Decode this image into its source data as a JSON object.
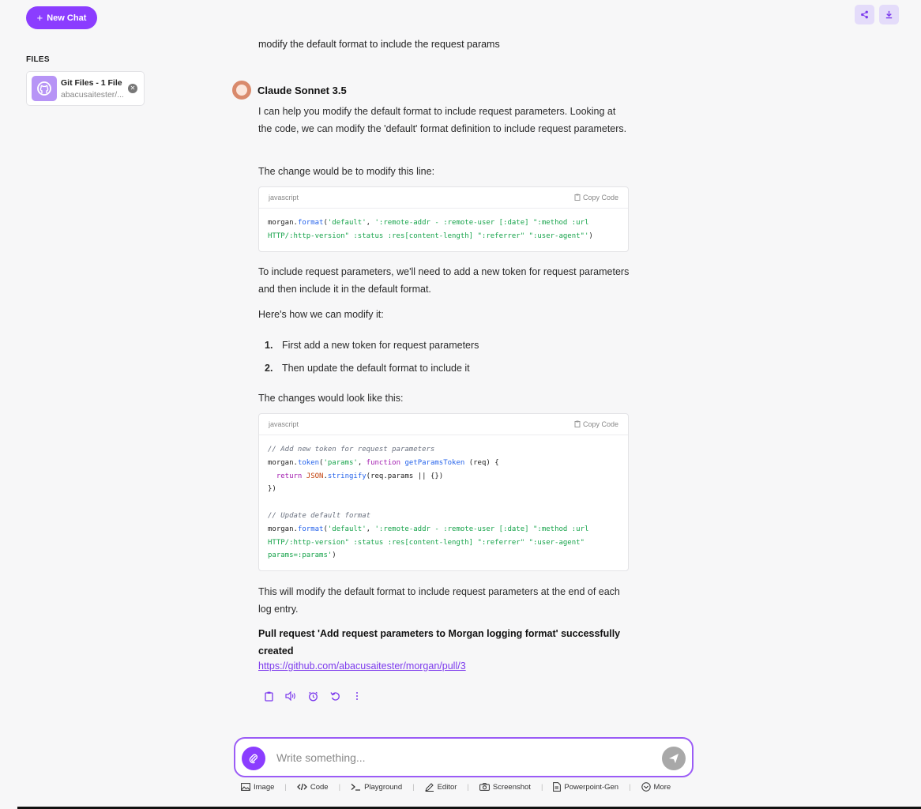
{
  "sidebar": {
    "new_chat_label": "New Chat",
    "files_heading": "FILES",
    "file": {
      "title": "Git Files - 1 File",
      "subtitle": "abacusaitester/..."
    }
  },
  "header_icons": [
    "share-icon",
    "download-icon"
  ],
  "conversation": {
    "user_message": "modify the default format to include the request params",
    "assistant_name": "Claude Sonnet 3.5",
    "para1": "I can help you modify the default format to include request parameters. Looking at the code, we can modify the 'default' format definition to include request parameters.",
    "para2": "The change would be to modify this line:",
    "code1": {
      "lang": "javascript",
      "copy_label": "Copy Code"
    },
    "para3": "To include request parameters, we'll need to add a new token for request parameters and then include it in the default format.",
    "para4": "Here's how we can modify it:",
    "steps": [
      {
        "num": "1.",
        "text": "First add a new token for request parameters"
      },
      {
        "num": "2.",
        "text": "Then update the default format to include it"
      }
    ],
    "para5": "The changes would look like this:",
    "code2": {
      "lang": "javascript",
      "copy_label": "Copy Code"
    },
    "para6": "This will modify the default format to include request parameters at the end of each log entry.",
    "pr_status": "Pull request 'Add request parameters to Morgan logging format' successfully created",
    "pr_link": "https://github.com/abacusaitester/morgan/pull/3"
  },
  "composer": {
    "placeholder": "Write something...",
    "tools": [
      {
        "icon": "image-icon",
        "label": "Image"
      },
      {
        "icon": "code-icon",
        "label": "Code"
      },
      {
        "icon": "terminal-icon",
        "label": "Playground"
      },
      {
        "icon": "pen-icon",
        "label": "Editor"
      },
      {
        "icon": "camera-icon",
        "label": "Screenshot"
      },
      {
        "icon": "document-icon",
        "label": "Powerpoint-Gen"
      },
      {
        "icon": "chevron-circle-icon",
        "label": "More"
      }
    ]
  },
  "colors": {
    "accent": "#8b3dff",
    "background": "#f7f7f8",
    "link": "#7c3aed"
  }
}
